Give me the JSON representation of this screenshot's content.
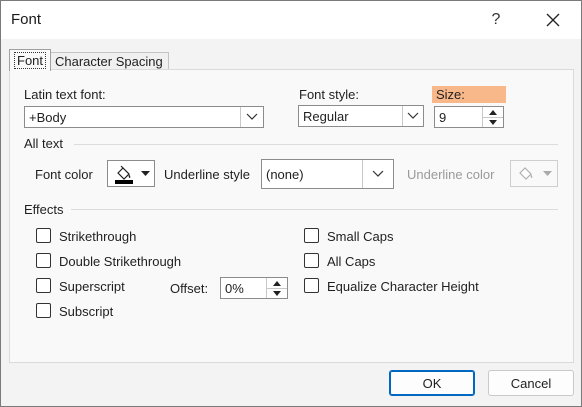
{
  "dialog": {
    "title": "Font",
    "help_label": "?"
  },
  "tabs": [
    {
      "label": "Font",
      "active": true
    },
    {
      "label": "Character Spacing",
      "active": false
    }
  ],
  "font_tab": {
    "latin_font": {
      "label": "Latin text font:",
      "value": "+Body"
    },
    "font_style": {
      "label": "Font style:",
      "value": "Regular"
    },
    "size": {
      "label": "Size:",
      "value": "9",
      "highlight_color": "#f8b88a"
    },
    "all_text": {
      "section_label": "All text",
      "font_color_label": "Font color",
      "underline_style_label": "Underline style",
      "underline_style_value": "(none)",
      "underline_color_label": "Underline color"
    },
    "effects": {
      "section_label": "Effects",
      "left": [
        {
          "label": "Strikethrough",
          "checked": false
        },
        {
          "label": "Double Strikethrough",
          "checked": false
        },
        {
          "label": "Superscript",
          "checked": false
        },
        {
          "label": "Subscript",
          "checked": false
        }
      ],
      "right": [
        {
          "label": "Small Caps",
          "checked": false
        },
        {
          "label": "All Caps",
          "checked": false
        },
        {
          "label": "Equalize Character Height",
          "checked": false
        }
      ],
      "offset": {
        "label": "Offset:",
        "value": "0%"
      }
    }
  },
  "buttons": {
    "ok": "OK",
    "cancel": "Cancel"
  },
  "colors": {
    "accent": "#0067c0",
    "font_color_swatch": "#000000"
  }
}
